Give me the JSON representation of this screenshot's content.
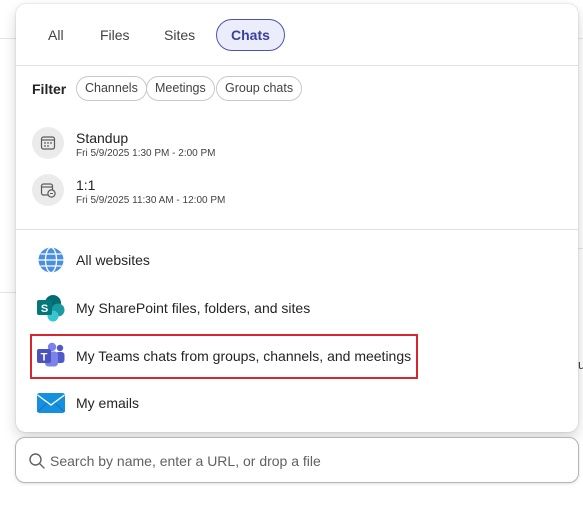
{
  "tabs": [
    {
      "label": "All",
      "active": false
    },
    {
      "label": "Files",
      "active": false
    },
    {
      "label": "Sites",
      "active": false
    },
    {
      "label": "Chats",
      "active": true
    }
  ],
  "filter": {
    "label": "Filter",
    "chips": [
      "Channels",
      "Meetings",
      "Group chats"
    ]
  },
  "results": [
    {
      "title": "Standup",
      "subtitle": "Fri 5/9/2025 1:30 PM - 2:00 PM",
      "icon": "calendar-icon"
    },
    {
      "title": "1:1",
      "subtitle": "Fri 5/9/2025 11:30 AM - 12:00 PM",
      "icon": "calendar-chat-icon"
    }
  ],
  "sources": [
    {
      "label": "All websites",
      "icon": "globe-icon"
    },
    {
      "label": "My SharePoint files, folders, and sites",
      "icon": "sharepoint-icon"
    },
    {
      "label": "My Teams chats from groups, channels, and meetings",
      "icon": "teams-icon",
      "highlighted": true
    },
    {
      "label": "My emails",
      "icon": "mail-icon"
    }
  ],
  "search": {
    "placeholder": "Search by name, enter a URL, or drop a file",
    "value": ""
  },
  "background": {
    "partial_text_right": "u"
  },
  "colors": {
    "accent": "#4f52b2",
    "highlight": "#d7262e"
  }
}
